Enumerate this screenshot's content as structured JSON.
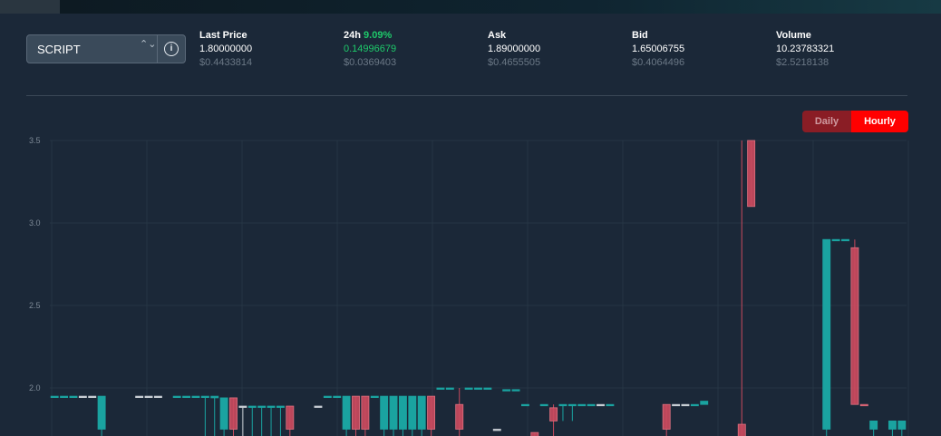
{
  "market": {
    "symbol": "SCRIPT",
    "caret_glyph": "⌃⌄",
    "info_glyph": "i"
  },
  "stats": {
    "last_price": {
      "label": "Last Price",
      "value": "1.80000000",
      "usd": "$0.4433814"
    },
    "change_24h": {
      "label": "24h",
      "percent": "9.09%",
      "value": "0.14996679",
      "usd": "$0.0369403"
    },
    "ask": {
      "label": "Ask",
      "value": "1.89000000",
      "usd": "$0.4655505"
    },
    "bid": {
      "label": "Bid",
      "value": "1.65006755",
      "usd": "$0.4064496"
    },
    "volume": {
      "label": "Volume",
      "value": "10.23783321",
      "usd": "$2.5218138"
    }
  },
  "interval_toggle": {
    "daily_label": "Daily",
    "hourly_label": "Hourly",
    "selected": "Hourly"
  },
  "colors": {
    "up": "#1aa3a0",
    "down": "#c94a5e",
    "neutral": "#c8ced4",
    "grid": "#263544",
    "green": "#1ec96a",
    "active": "#ff0000"
  },
  "chart_data": {
    "type": "candlestick",
    "ylim": [
      1.7,
      3.5
    ],
    "yticks": [
      2.0,
      2.5,
      3.0,
      3.5
    ],
    "ytick_labels": [
      "2.0",
      "2.5",
      "3.0",
      "3.5"
    ],
    "candles": [
      {
        "open": 1.95,
        "close": 1.95,
        "high": 1.95,
        "low": 1.95,
        "dir": "up"
      },
      {
        "open": 1.95,
        "close": 1.95,
        "high": 1.95,
        "low": 1.95,
        "dir": "up"
      },
      {
        "open": 1.95,
        "close": 1.95,
        "high": 1.95,
        "low": 1.95,
        "dir": "up"
      },
      {
        "open": 1.95,
        "close": 1.95,
        "high": 1.95,
        "low": 1.95,
        "dir": "neutral"
      },
      {
        "open": 1.95,
        "close": 1.95,
        "high": 1.95,
        "low": 1.95,
        "dir": "neutral"
      },
      {
        "open": 1.75,
        "close": 1.95,
        "high": 1.95,
        "low": 1.7,
        "dir": "up"
      },
      null,
      null,
      null,
      {
        "open": 1.95,
        "close": 1.95,
        "high": 1.95,
        "low": 1.95,
        "dir": "neutral"
      },
      {
        "open": 1.95,
        "close": 1.95,
        "high": 1.95,
        "low": 1.95,
        "dir": "neutral"
      },
      {
        "open": 1.95,
        "close": 1.95,
        "high": 1.95,
        "low": 1.95,
        "dir": "neutral"
      },
      null,
      {
        "open": 1.95,
        "close": 1.95,
        "high": 1.95,
        "low": 1.95,
        "dir": "up"
      },
      {
        "open": 1.95,
        "close": 1.95,
        "high": 1.95,
        "low": 1.95,
        "dir": "up"
      },
      {
        "open": 1.95,
        "close": 1.95,
        "high": 1.95,
        "low": 1.95,
        "dir": "up"
      },
      {
        "open": 1.95,
        "close": 1.95,
        "high": 1.95,
        "low": 1.7,
        "dir": "up"
      },
      {
        "open": 1.95,
        "close": 1.94,
        "high": 1.95,
        "low": 1.7,
        "dir": "up"
      },
      {
        "open": 1.75,
        "close": 1.94,
        "high": 1.94,
        "low": 1.7,
        "dir": "up"
      },
      {
        "open": 1.94,
        "close": 1.75,
        "high": 1.94,
        "low": 1.7,
        "dir": "down"
      },
      {
        "open": 1.89,
        "close": 1.89,
        "high": 1.89,
        "low": 1.7,
        "dir": "neutral"
      },
      {
        "open": 1.89,
        "close": 1.89,
        "high": 1.89,
        "low": 1.7,
        "dir": "up"
      },
      {
        "open": 1.89,
        "close": 1.89,
        "high": 1.89,
        "low": 1.7,
        "dir": "up"
      },
      {
        "open": 1.89,
        "close": 1.89,
        "high": 1.89,
        "low": 1.7,
        "dir": "up"
      },
      {
        "open": 1.89,
        "close": 1.89,
        "high": 1.89,
        "low": 1.7,
        "dir": "up"
      },
      {
        "open": 1.89,
        "close": 1.75,
        "high": 1.89,
        "low": 1.7,
        "dir": "down"
      },
      null,
      null,
      {
        "open": 1.89,
        "close": 1.89,
        "high": 1.89,
        "low": 1.89,
        "dir": "neutral"
      },
      {
        "open": 1.95,
        "close": 1.95,
        "high": 1.95,
        "low": 1.95,
        "dir": "up"
      },
      {
        "open": 1.95,
        "close": 1.95,
        "high": 1.95,
        "low": 1.95,
        "dir": "up"
      },
      {
        "open": 1.75,
        "close": 1.95,
        "high": 1.95,
        "low": 1.7,
        "dir": "up"
      },
      {
        "open": 1.95,
        "close": 1.75,
        "high": 1.95,
        "low": 1.7,
        "dir": "down"
      },
      {
        "open": 1.95,
        "close": 1.75,
        "high": 1.95,
        "low": 1.7,
        "dir": "down"
      },
      {
        "open": 1.95,
        "close": 1.95,
        "high": 1.95,
        "low": 1.95,
        "dir": "up"
      },
      {
        "open": 1.75,
        "close": 1.95,
        "high": 1.95,
        "low": 1.7,
        "dir": "up"
      },
      {
        "open": 1.75,
        "close": 1.95,
        "high": 1.95,
        "low": 1.7,
        "dir": "up"
      },
      {
        "open": 1.75,
        "close": 1.95,
        "high": 1.95,
        "low": 1.7,
        "dir": "up"
      },
      {
        "open": 1.75,
        "close": 1.95,
        "high": 1.95,
        "low": 1.7,
        "dir": "up"
      },
      {
        "open": 1.75,
        "close": 1.95,
        "high": 1.95,
        "low": 1.7,
        "dir": "up"
      },
      {
        "open": 1.95,
        "close": 1.75,
        "high": 1.95,
        "low": 1.7,
        "dir": "down"
      },
      {
        "open": 2.0,
        "close": 2.0,
        "high": 2.0,
        "low": 2.0,
        "dir": "up"
      },
      {
        "open": 2.0,
        "close": 2.0,
        "high": 2.0,
        "low": 2.0,
        "dir": "up"
      },
      {
        "open": 1.9,
        "close": 1.75,
        "high": 2.0,
        "low": 1.7,
        "dir": "down"
      },
      {
        "open": 2.0,
        "close": 2.0,
        "high": 2.0,
        "low": 2.0,
        "dir": "up"
      },
      {
        "open": 2.0,
        "close": 2.0,
        "high": 2.0,
        "low": 2.0,
        "dir": "up"
      },
      {
        "open": 2.0,
        "close": 2.0,
        "high": 2.0,
        "low": 2.0,
        "dir": "up"
      },
      {
        "open": 1.75,
        "close": 1.75,
        "high": 1.75,
        "low": 1.75,
        "dir": "neutral"
      },
      {
        "open": 1.99,
        "close": 1.99,
        "high": 1.99,
        "low": 1.99,
        "dir": "up"
      },
      {
        "open": 1.99,
        "close": 1.99,
        "high": 1.99,
        "low": 1.99,
        "dir": "up"
      },
      {
        "open": 1.9,
        "close": 1.9,
        "high": 1.9,
        "low": 1.9,
        "dir": "up"
      },
      {
        "open": 1.73,
        "close": 1.7,
        "high": 1.73,
        "low": 1.7,
        "dir": "down"
      },
      {
        "open": 1.9,
        "close": 1.9,
        "high": 1.9,
        "low": 1.9,
        "dir": "up"
      },
      {
        "open": 1.88,
        "close": 1.8,
        "high": 1.9,
        "low": 1.7,
        "dir": "down"
      },
      {
        "open": 1.9,
        "close": 1.9,
        "high": 1.9,
        "low": 1.8,
        "dir": "up"
      },
      {
        "open": 1.9,
        "close": 1.9,
        "high": 1.9,
        "low": 1.8,
        "dir": "up"
      },
      {
        "open": 1.9,
        "close": 1.9,
        "high": 1.9,
        "low": 1.9,
        "dir": "up"
      },
      {
        "open": 1.9,
        "close": 1.9,
        "high": 1.9,
        "low": 1.9,
        "dir": "up"
      },
      {
        "open": 1.9,
        "close": 1.9,
        "high": 1.9,
        "low": 1.9,
        "dir": "neutral"
      },
      {
        "open": 1.9,
        "close": 1.9,
        "high": 1.9,
        "low": 1.9,
        "dir": "up"
      },
      null,
      null,
      null,
      null,
      null,
      {
        "open": 1.9,
        "close": 1.75,
        "high": 1.9,
        "low": 1.7,
        "dir": "down"
      },
      {
        "open": 1.9,
        "close": 1.9,
        "high": 1.9,
        "low": 1.9,
        "dir": "neutral"
      },
      {
        "open": 1.9,
        "close": 1.9,
        "high": 1.9,
        "low": 1.9,
        "dir": "neutral"
      },
      {
        "open": 1.9,
        "close": 1.9,
        "high": 1.9,
        "low": 1.9,
        "dir": "up"
      },
      {
        "open": 1.9,
        "close": 1.92,
        "high": 1.92,
        "low": 1.9,
        "dir": "up"
      },
      null,
      null,
      null,
      {
        "open": 1.78,
        "close": 1.7,
        "high": 3.5,
        "low": 1.7,
        "dir": "down"
      },
      {
        "open": 3.5,
        "close": 3.1,
        "high": 3.5,
        "low": 3.1,
        "dir": "down"
      },
      null,
      null,
      null,
      null,
      null,
      null,
      null,
      {
        "open": 1.75,
        "close": 2.9,
        "high": 2.9,
        "low": 1.7,
        "dir": "up"
      },
      {
        "open": 2.9,
        "close": 2.9,
        "high": 2.9,
        "low": 2.9,
        "dir": "up"
      },
      {
        "open": 2.9,
        "close": 2.9,
        "high": 2.9,
        "low": 2.9,
        "dir": "up"
      },
      {
        "open": 2.85,
        "close": 1.9,
        "high": 2.9,
        "low": 1.9,
        "dir": "down"
      },
      {
        "open": 1.9,
        "close": 1.9,
        "high": 1.9,
        "low": 1.9,
        "dir": "down"
      },
      {
        "open": 1.75,
        "close": 1.8,
        "high": 1.8,
        "low": 1.7,
        "dir": "up"
      },
      null,
      {
        "open": 1.75,
        "close": 1.8,
        "high": 1.8,
        "low": 1.7,
        "dir": "up"
      },
      {
        "open": 1.75,
        "close": 1.8,
        "high": 1.8,
        "low": 1.7,
        "dir": "up"
      }
    ]
  }
}
